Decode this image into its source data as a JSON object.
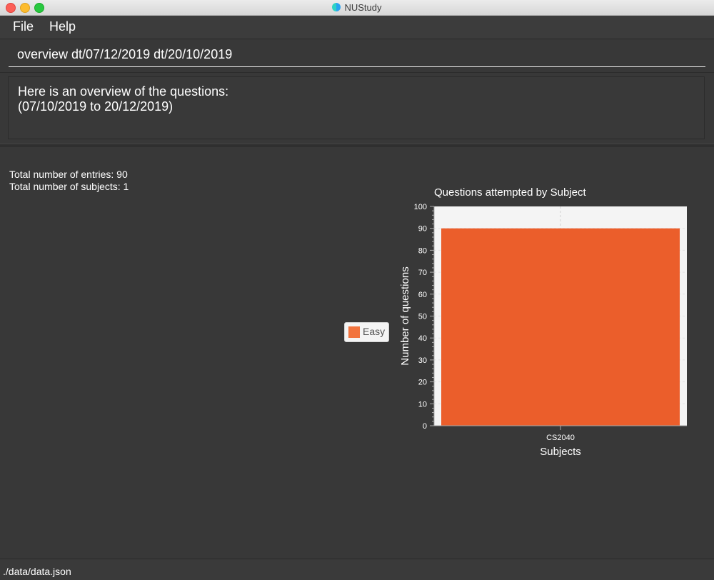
{
  "window": {
    "title": "NUStudy"
  },
  "menu": {
    "items": [
      "File",
      "Help"
    ]
  },
  "command": {
    "value": "overview dt/07/12/2019 dt/20/10/2019"
  },
  "result": {
    "lines": [
      "Here is an overview of the questions:",
      "(07/10/2019 to 20/12/2019)"
    ]
  },
  "stats": {
    "entries": "Total number of entries: 90",
    "subjects": "Total number of subjects: 1"
  },
  "legend": {
    "label": "Easy"
  },
  "status": {
    "path": "./data/data.json"
  },
  "colors": {
    "bar": "#eb5e2b",
    "legend_swatch": "#f2743e",
    "background": "#383838"
  },
  "chart_data": {
    "type": "bar",
    "title": "Questions attempted by Subject",
    "xlabel": "Subjects",
    "ylabel": "Number of questions",
    "categories": [
      "CS2040"
    ],
    "series": [
      {
        "name": "Easy",
        "values": [
          90
        ]
      }
    ],
    "ylim": [
      0,
      100
    ],
    "yticks": [
      0,
      10,
      20,
      30,
      40,
      50,
      60,
      70,
      80,
      90,
      100
    ],
    "grid": true,
    "legend": "left"
  }
}
